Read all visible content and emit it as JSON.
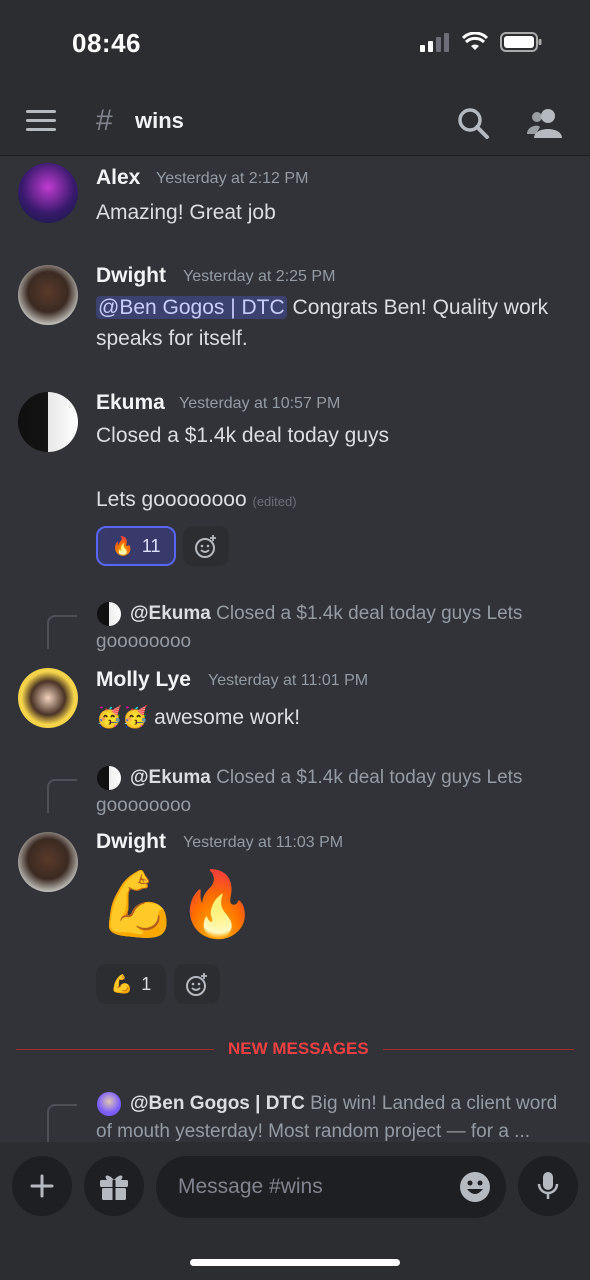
{
  "status": {
    "time": "08:46"
  },
  "header": {
    "hash": "#",
    "channel": "wins"
  },
  "messages": [
    {
      "user": "Alex",
      "time": "Yesterday at 2:12 PM",
      "text": "Amazing! Great job"
    },
    {
      "user": "Dwight",
      "time": "Yesterday at 2:25 PM",
      "mention": "@Ben Gogos | DTC",
      "text": " Congrats Ben! Quality work speaks for itself."
    },
    {
      "user": "Ekuma",
      "time": "Yesterday at 10:57 PM",
      "text": "Closed a $1.4k deal today guys",
      "text2": "Lets goooooooo",
      "edited": "(edited)",
      "reaction": {
        "emoji": "🔥",
        "count": "11"
      }
    },
    {
      "reply": {
        "user": "@Ekuma",
        "text": "Closed a $1.4k deal today guys  Lets goooooooo"
      },
      "user": "Molly Lye",
      "time": "Yesterday at 11:01 PM",
      "emojis": "🥳🥳",
      "text": "awesome work!"
    },
    {
      "reply": {
        "user": "@Ekuma",
        "text": "Closed a $1.4k deal today guys  Lets goooooooo"
      },
      "user": "Dwight",
      "time": "Yesterday at 11:03 PM",
      "emojis": "💪🔥",
      "reaction": {
        "emoji": "💪",
        "count": "1"
      }
    }
  ],
  "divider": {
    "label": "NEW MESSAGES"
  },
  "new_reply": {
    "user": "@Ben Gogos | DTC",
    "text": "Big win! Landed a client word of mouth yesterday!  Most random project — for a ..."
  },
  "composer": {
    "placeholder": "Message #wins"
  },
  "icons": [
    "hamburger-icon",
    "search-icon",
    "members-icon",
    "plus-icon",
    "gift-icon",
    "emoji-icon",
    "mic-icon",
    "add-reaction-icon"
  ],
  "colors": {
    "background": "#313338",
    "header": "#2b2d31",
    "accent": "#5865f2",
    "new_messages": "#f23f43",
    "mention_bg": "#3c4270"
  }
}
